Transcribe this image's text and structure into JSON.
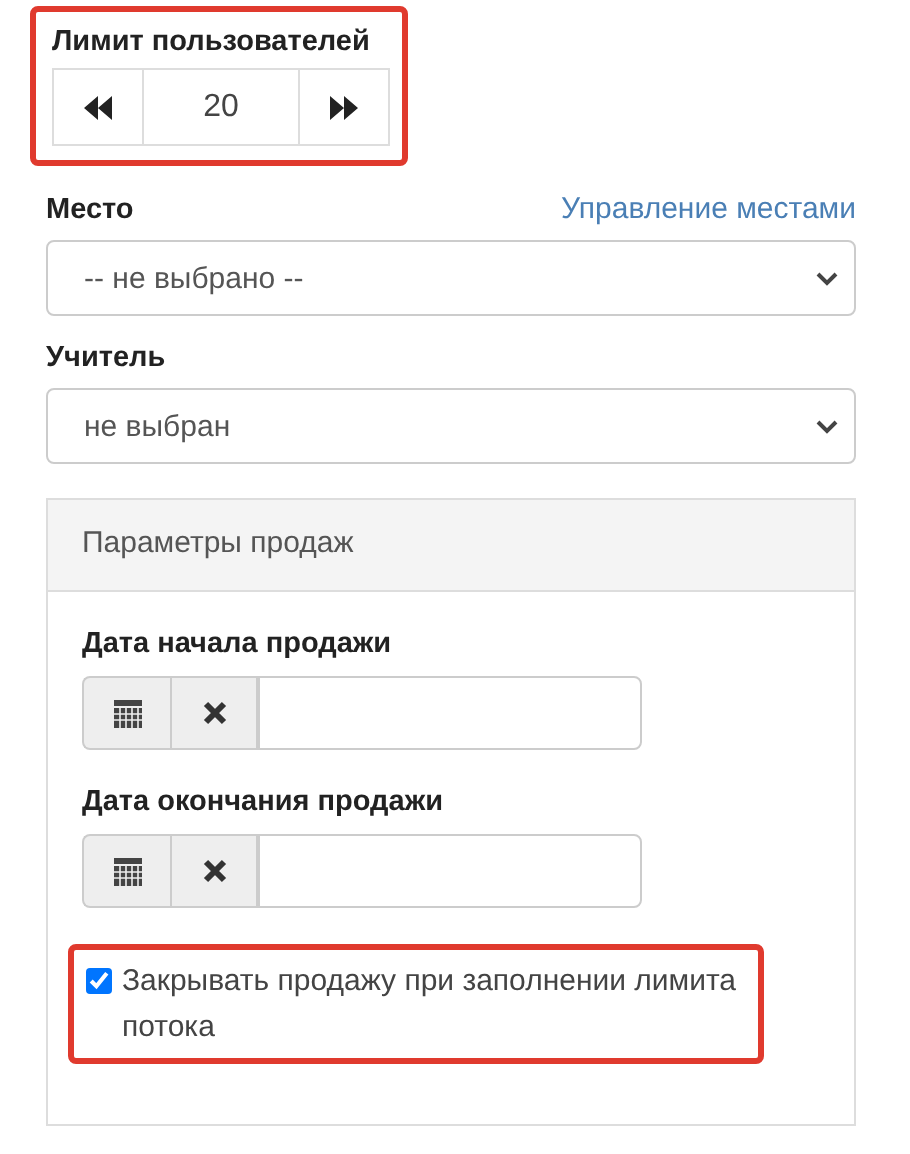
{
  "user_limit": {
    "label": "Лимит пользователей",
    "value": "20",
    "highlighted": true
  },
  "place": {
    "label": "Место",
    "link": "Управление местами",
    "value": "-- не выбрано --"
  },
  "teacher": {
    "label": "Учитель",
    "value": "не выбран"
  },
  "sales_panel": {
    "title": "Параметры продаж",
    "dates": [
      {
        "label": "Дата начала продажи"
      },
      {
        "label": "Дата окончания продажи"
      }
    ],
    "close_on_full": {
      "label": "Закрывать продажу при заполнении лимита потока",
      "checked": true,
      "highlighted": true
    }
  }
}
